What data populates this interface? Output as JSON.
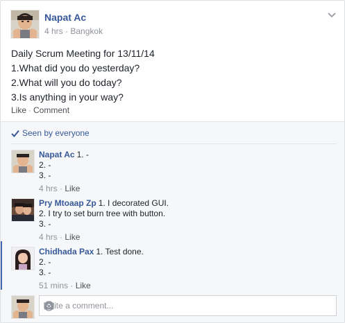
{
  "post": {
    "author": "Napat Ac",
    "time": "4 hrs",
    "location": "Bangkok",
    "meta_separator": "·",
    "text_lines": [
      "Daily Scrum Meeting for 13/11/14",
      "1.What did you do yesterday?",
      "2.What will you do today?",
      "3.Is anything in your way?"
    ],
    "actions": {
      "like": "Like",
      "separator": "·",
      "comment": "Comment"
    }
  },
  "feedback": {
    "seen_by": "Seen by everyone",
    "comments": [
      {
        "name": "Napat Ac",
        "lines": [
          "1. -",
          "2. -",
          "3. -"
        ],
        "time": "4 hrs",
        "like": "Like"
      },
      {
        "name": "Pry Mtoaap Zp",
        "lines": [
          "1. I decorated GUI.",
          "2. I try to set burn tree with button.",
          "3. -"
        ],
        "time": "4 hrs",
        "like": "Like"
      },
      {
        "name": "Chidhada Pax",
        "lines": [
          "1. Test done.",
          "2. -",
          "3. -"
        ],
        "time": "51 mins",
        "like": "Like"
      }
    ],
    "meta_separator": "·",
    "composer_placeholder": "Write a comment..."
  },
  "colors": {
    "link": "#365899",
    "accent": "#4267b2",
    "meta": "#90949c",
    "feedback_bg": "#f6f7f9"
  },
  "icons": [
    "chevron-down-icon",
    "checkmark-icon",
    "camera-icon",
    "smiley-icon"
  ]
}
